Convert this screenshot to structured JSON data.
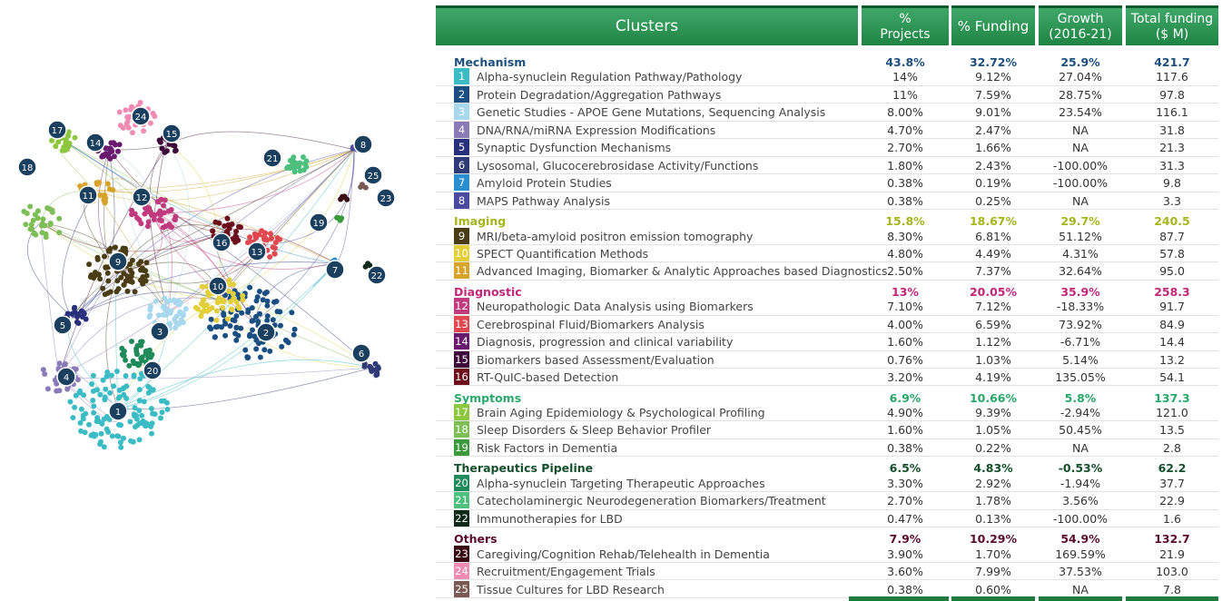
{
  "colors": {
    "mechanism": "#1c4f7c",
    "imaging": "#a6b51a",
    "diagnostic": "#c0267a",
    "symptoms": "#28a86a",
    "therapeutics": "#14502b",
    "others": "#5a0e2c",
    "header_green": "#2a9553"
  },
  "headers": {
    "clusters": "Clusters",
    "projects_1": "%",
    "projects_2": "Projects",
    "funding": "% Funding",
    "growth_1": "Growth",
    "growth_2": "(2016-21)",
    "total_1": "Total funding",
    "total_2": "($ M)"
  },
  "groups": [
    {
      "name": "Mechanism",
      "color": "#1c4f7c",
      "projects": "43.8%",
      "funding": "32.72%",
      "growth": "25.9%",
      "total": "421.7",
      "items": [
        {
          "n": "1",
          "color": "#3bbcc4",
          "name": "Alpha-synuclein Regulation Pathway/Pathology",
          "projects": "14%",
          "funding": "9.12%",
          "growth": "27.04%",
          "total": "117.6"
        },
        {
          "n": "2",
          "color": "#1b4f82",
          "name": "Protein Degradation/Aggregation Pathways",
          "projects": "11%",
          "funding": "7.59%",
          "growth": "28.75%",
          "total": "97.8"
        },
        {
          "n": "3",
          "color": "#a8d8ee",
          "name": "Genetic Studies - APOE Gene Mutations, Sequencing Analysis",
          "projects": "8.00%",
          "funding": "9.01%",
          "growth": "23.54%",
          "total": "116.1"
        },
        {
          "n": "4",
          "color": "#8a7ab8",
          "name": "DNA/RNA/miRNA Expression Modifications",
          "projects": "4.70%",
          "funding": "2.47%",
          "growth": "NA",
          "total": "31.8"
        },
        {
          "n": "5",
          "color": "#27307a",
          "name": "Synaptic Dysfunction Mechanisms",
          "projects": "2.70%",
          "funding": "1.66%",
          "growth": "NA",
          "total": "21.3"
        },
        {
          "n": "6",
          "color": "#2f3b78",
          "name": "Lysosomal, Glucocerebrosidase Activity/Functions",
          "projects": "1.80%",
          "funding": "2.43%",
          "growth": "-100.00%",
          "total": "31.3"
        },
        {
          "n": "7",
          "color": "#2a8fd0",
          "name": "Amyloid Protein Studies",
          "projects": "0.38%",
          "funding": "0.19%",
          "growth": "-100.00%",
          "total": "9.8"
        },
        {
          "n": "8",
          "color": "#4a4aa0",
          "name": "MAPS Pathway  Analysis",
          "projects": "0.38%",
          "funding": "0.25%",
          "growth": "NA",
          "total": "3.3"
        }
      ]
    },
    {
      "name": "Imaging",
      "color": "#a6b51a",
      "projects": "15.8%",
      "funding": "18.67%",
      "growth": "29.7%",
      "total": "240.5",
      "items": [
        {
          "n": "9",
          "color": "#4a3c14",
          "name": "MRI/beta-amyloid positron emission tomography",
          "projects": "8.30%",
          "funding": "6.81%",
          "growth": "51.12%",
          "total": "87.7"
        },
        {
          "n": "10",
          "color": "#e3cf3a",
          "name": "SPECT Quantification Methods",
          "projects": "4.80%",
          "funding": "4.49%",
          "growth": "4.31%",
          "total": "57.8"
        },
        {
          "n": "11",
          "color": "#d6a42a",
          "name": "Advanced Imaging, Biomarker & Analytic Approaches based Diagnostics",
          "projects": "2.50%",
          "funding": "7.37%",
          "growth": "32.64%",
          "total": "95.0"
        }
      ]
    },
    {
      "name": "Diagnostic",
      "color": "#c0267a",
      "projects": "13%",
      "funding": "20.05%",
      "growth": "35.9%",
      "total": "258.3",
      "items": [
        {
          "n": "12",
          "color": "#c1397e",
          "name": "Neuropathologic Data Analysis using Biomarkers",
          "projects": "7.10%",
          "funding": "7.12%",
          "growth": "-18.33%",
          "total": "91.7"
        },
        {
          "n": "13",
          "color": "#e0474f",
          "name": "Cerebrospinal Fluid/Biomarkers Analysis",
          "projects": "4.00%",
          "funding": "6.59%",
          "growth": "73.92%",
          "total": "84.9"
        },
        {
          "n": "14",
          "color": "#6a1a6e",
          "name": "Diagnosis, progression and clinical variability",
          "projects": "1.60%",
          "funding": "1.12%",
          "growth": "-6.71%",
          "total": "14.4"
        },
        {
          "n": "15",
          "color": "#3e0a3a",
          "name": "Biomarkers based Assessment/Evaluation",
          "projects": "0.76%",
          "funding": "1.03%",
          "growth": "5.14%",
          "total": "13.2"
        },
        {
          "n": "16",
          "color": "#6c0f1a",
          "name": "RT-QuIC-based Detection",
          "projects": "3.20%",
          "funding": "4.19%",
          "growth": "135.05%",
          "total": "54.1"
        }
      ]
    },
    {
      "name": "Symptoms",
      "color": "#28a86a",
      "projects": "6.9%",
      "funding": "10.66%",
      "growth": "5.8%",
      "total": "137.3",
      "items": [
        {
          "n": "17",
          "color": "#8dc63f",
          "name": "Brain Aging Epidemiology & Psychological Profiling",
          "projects": "4.90%",
          "funding": "9.39%",
          "growth": "-2.94%",
          "total": "121.0"
        },
        {
          "n": "18",
          "color": "#7ebe56",
          "name": "Sleep Disorders & Sleep Behavior Profiler",
          "projects": "1.60%",
          "funding": "1.05%",
          "growth": "50.45%",
          "total": "13.5"
        },
        {
          "n": "19",
          "color": "#3a9a3c",
          "name": "Risk Factors  in Dementia",
          "projects": "0.38%",
          "funding": "0.22%",
          "growth": "NA",
          "total": "2.8"
        }
      ]
    },
    {
      "name": "Therapeutics Pipeline",
      "color": "#14502b",
      "projects": "6.5%",
      "funding": "4.83%",
      "growth": "-0.53%",
      "total": "62.2",
      "items": [
        {
          "n": "20",
          "color": "#1f8a5a",
          "name": "Alpha-synuclein Targeting Therapeutic Approaches",
          "projects": "3.30%",
          "funding": "2.92%",
          "growth": "-1.94%",
          "total": "37.7"
        },
        {
          "n": "21",
          "color": "#4cc07c",
          "name": "Catecholaminergic Neurodegeneration Biomarkers/Treatment",
          "projects": "2.70%",
          "funding": "1.78%",
          "growth": "3.56%",
          "total": "22.9"
        },
        {
          "n": "22",
          "color": "#0f2a18",
          "name": "Immunotherapies for LBD",
          "projects": "0.47%",
          "funding": "0.13%",
          "growth": "-100.00%",
          "total": "1.6"
        }
      ]
    },
    {
      "name": "Others",
      "color": "#5a0e2c",
      "projects": "7.9%",
      "funding": "10.29%",
      "growth": "54.9%",
      "total": "132.7",
      "items": [
        {
          "n": "23",
          "color": "#3a0a12",
          "name": "Caregiving/Cognition Rehab/Telehealth in Dementia",
          "projects": "3.90%",
          "funding": "1.70%",
          "growth": "169.59%",
          "total": "21.9"
        },
        {
          "n": "24",
          "color": "#f08cb4",
          "name": "Recruitment/Engagement Trials",
          "projects": "3.60%",
          "funding": "7.99%",
          "growth": "37.53%",
          "total": "103.0"
        },
        {
          "n": "25",
          "color": "#7a5a52",
          "name": "Tissue Cultures for LBD Research",
          "projects": "0.38%",
          "funding": "0.60%",
          "growth": "NA",
          "total": "7.8"
        }
      ]
    }
  ],
  "network_labels": [
    "24",
    "17",
    "14",
    "15",
    "18",
    "8",
    "21",
    "25",
    "11",
    "12",
    "23",
    "19",
    "16",
    "13",
    "9",
    "7",
    "22",
    "10",
    "5",
    "3",
    "2",
    "6",
    "4",
    "20",
    "1"
  ]
}
